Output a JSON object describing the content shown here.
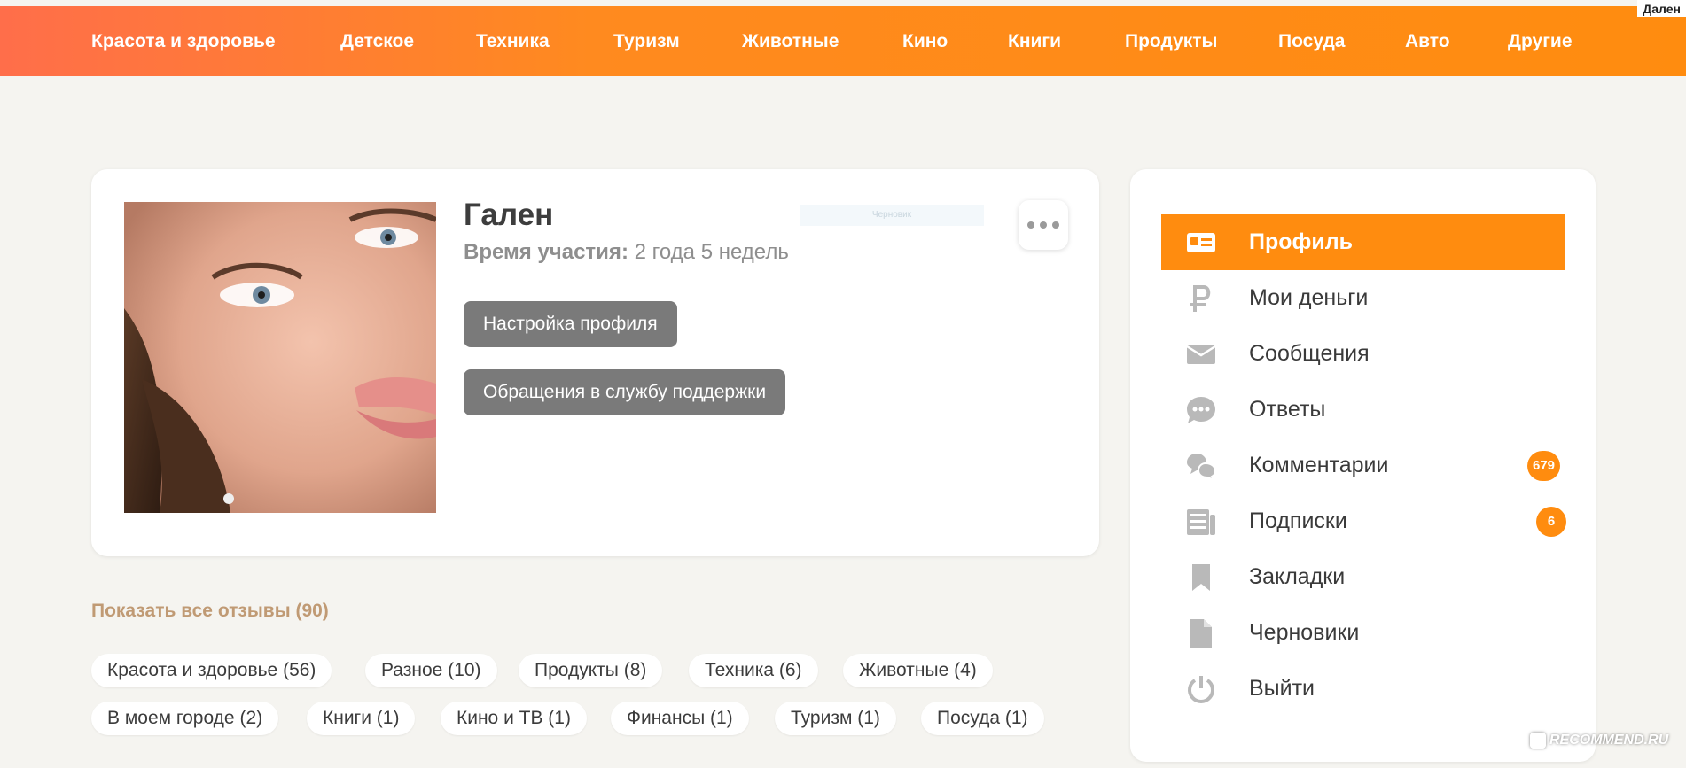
{
  "corner_label": "Дален",
  "nav": [
    "Красота и здоровье",
    "Детское",
    "Техника",
    "Туризм",
    "Животные",
    "Кино",
    "Книги",
    "Продукты",
    "Посуда",
    "Авто",
    "Другие"
  ],
  "profile": {
    "name": "Гален",
    "member_label": "Время участия:",
    "member_value": "2 года 5 недель",
    "faint_box_text": "Черновик",
    "more_icon": "more-dots-icon",
    "buttons": {
      "settings": "Настройка профиля",
      "support": "Обращения в службу поддержки"
    }
  },
  "reviews": {
    "show_all": "Показать все отзывы (90)",
    "tags": [
      "Красота и здоровье (56)",
      "Разное (10)",
      "Продукты (8)",
      "Техника (6)",
      "Животные (4)",
      "В моем городе (2)",
      "Книги (1)",
      "Кино и ТВ (1)",
      "Финансы (1)",
      "Туризм (1)",
      "Посуда (1)"
    ]
  },
  "sidebar": {
    "items": [
      {
        "label": "Профиль",
        "icon": "id-card-icon",
        "active": true
      },
      {
        "label": "Мои деньги",
        "icon": "ruble-icon"
      },
      {
        "label": "Сообщения",
        "icon": "envelope-icon"
      },
      {
        "label": "Ответы",
        "icon": "chat-bubble-icon"
      },
      {
        "label": "Комментарии",
        "icon": "comments-icon",
        "badge": "679"
      },
      {
        "label": "Подписки",
        "icon": "newspaper-icon",
        "badge": "6"
      },
      {
        "label": "Закладки",
        "icon": "bookmark-icon"
      },
      {
        "label": "Черновики",
        "icon": "document-icon"
      },
      {
        "label": "Выйти",
        "icon": "power-icon"
      }
    ]
  },
  "colors": {
    "accent": "#ff8c0f",
    "header_start": "#ff6e4a",
    "background": "#f5f4f0",
    "button_gray": "#7a7a7a",
    "icon_gray": "#b9b9b9",
    "link_tan": "#c09a74"
  },
  "watermark": "RECOMMEND.RU"
}
